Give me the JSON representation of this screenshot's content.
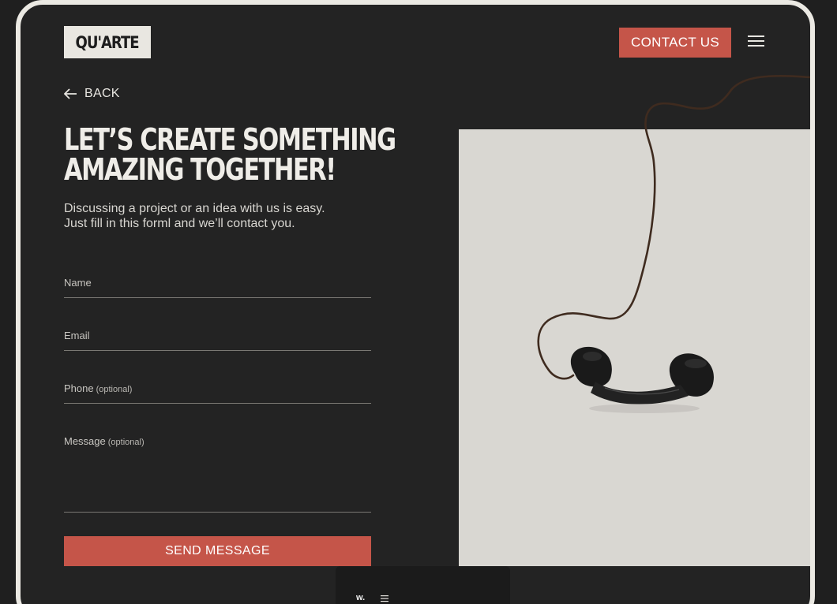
{
  "header": {
    "logo_text": "QU'ARTE",
    "contact_label": "CONTACT US",
    "menu_icon": "hamburger-icon"
  },
  "nav": {
    "back_label": "BACK",
    "back_icon": "arrow-left-icon"
  },
  "hero": {
    "headline_line1": "LET’S CREATE SOMETHING",
    "headline_line2": "AMAZING TOGETHER!",
    "subtext_line1": "Discussing a project or an idea with us is easy.",
    "subtext_line2": "Just fill in this forml and we’ll contact you."
  },
  "form": {
    "name_label": "Name",
    "email_label": "Email",
    "phone_label": "Phone",
    "phone_optional": "(optional)",
    "message_label": "Message",
    "message_optional": "(optional)",
    "submit_label": "SEND MESSAGE"
  },
  "footer": {
    "badge_text": "w.",
    "menu_icon": "hamburger-small-icon"
  },
  "colors": {
    "accent": "#c55549",
    "background": "#232323",
    "image_bg": "#d9d7d2",
    "frame": "#ebe9e3"
  }
}
